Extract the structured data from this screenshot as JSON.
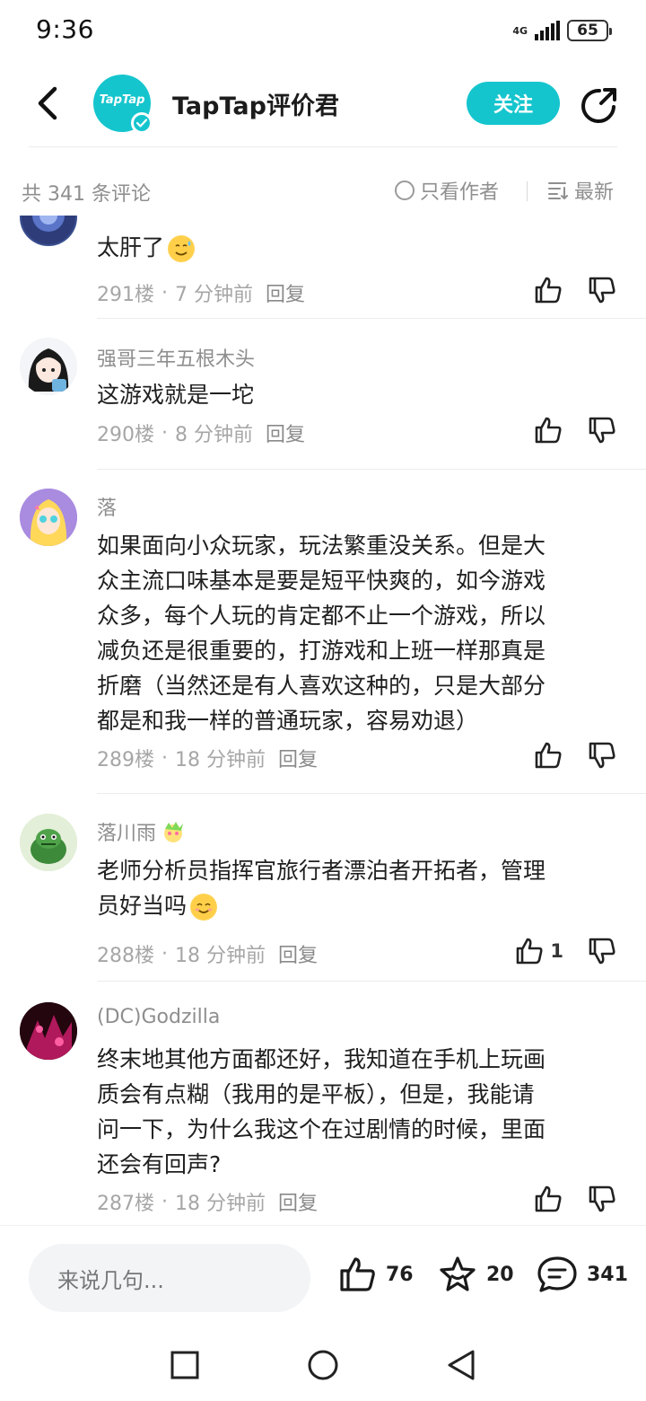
{
  "status_bar": {
    "time": "9:36",
    "network": "4G",
    "battery": "65"
  },
  "header": {
    "brand_text": "TapTap",
    "title": "TapTap评价君",
    "follow_label": "关注"
  },
  "filter": {
    "count_text": "共 341 条评论",
    "only_author_label": "只看作者",
    "sort_label": "最新"
  },
  "comments": [
    {
      "text": "太肝了",
      "floor": "291楼",
      "time": "7 分钟前",
      "reply": "回复"
    },
    {
      "name": "强哥三年五根木头",
      "text": "这游戏就是一坨",
      "floor": "290楼",
      "time": "8 分钟前",
      "reply": "回复"
    },
    {
      "name": "落",
      "lines": [
        "如果面向小众玩家，玩法繁重没关系。但是大",
        "众主流口味基本是要是短平快爽的，如今游戏",
        "众多，每个人玩的肯定都不止一个游戏，所以",
        "减负还是很重要的，打游戏和上班一样那真是",
        "折磨（当然还是有人喜欢这种的，只是大部分",
        "都是和我一样的普通玩家，容易劝退）"
      ],
      "floor": "289楼",
      "time": "18 分钟前",
      "reply": "回复"
    },
    {
      "name": "落川雨",
      "lines": [
        "老师分析员指挥官旅行者漂泊者开拓者，管理",
        "员好当吗"
      ],
      "floor": "288楼",
      "time": "18 分钟前",
      "reply": "回复",
      "likes": "1"
    },
    {
      "name": "(DC)Godzilla",
      "lines": [
        "终末地其他方面都还好，我知道在手机上玩画",
        "质会有点糊（我用的是平板），但是，我能请",
        "问一下，为什么我这个在过剧情的时候，里面",
        "还会有回声?"
      ],
      "floor": "287楼",
      "time": "18 分钟前",
      "reply": "回复"
    }
  ],
  "bottom_bar": {
    "input_placeholder": "来说几句...",
    "likes": "76",
    "favorites": "20",
    "comments": "341"
  },
  "colors": {
    "accent": "#15c5ce",
    "muted_text": "#a6a6a6",
    "primary_text": "#1f1f1f"
  }
}
